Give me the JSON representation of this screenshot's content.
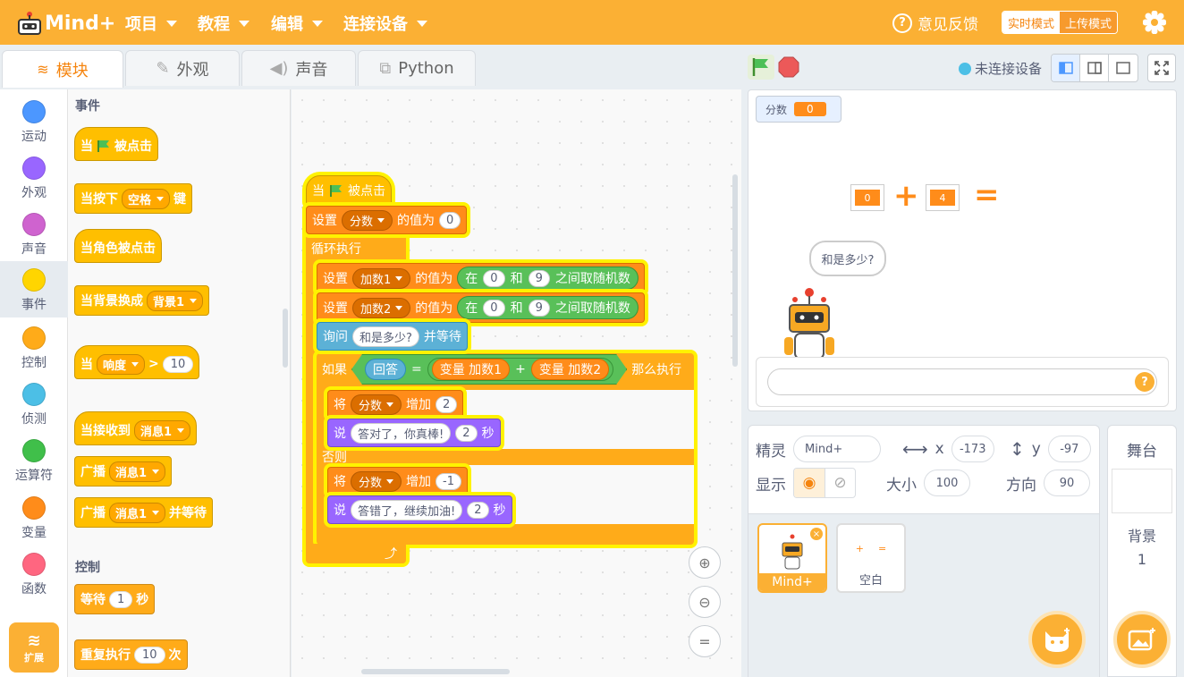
{
  "app": {
    "logo_text": "Mind+"
  },
  "menubar": {
    "menus": [
      {
        "label": "项目"
      },
      {
        "label": "教程"
      },
      {
        "label": "编辑"
      },
      {
        "label": "连接设备"
      }
    ],
    "feedback": "意见反馈",
    "mode_realtime": "实时模式",
    "mode_upload": "上传模式"
  },
  "tabs": [
    {
      "label": "模块"
    },
    {
      "label": "外观"
    },
    {
      "label": "声音"
    },
    {
      "label": "Python"
    }
  ],
  "categories": [
    {
      "label": "运动",
      "color": "#4c97ff"
    },
    {
      "label": "外观",
      "color": "#9966ff"
    },
    {
      "label": "声音",
      "color": "#cf63cf"
    },
    {
      "label": "事件",
      "color": "#ffd500"
    },
    {
      "label": "控制",
      "color": "#ffab19"
    },
    {
      "label": "侦测",
      "color": "#4cbfe6"
    },
    {
      "label": "运算符",
      "color": "#40bf4a"
    },
    {
      "label": "变量",
      "color": "#ff8c1a"
    },
    {
      "label": "函数",
      "color": "#ff6680"
    }
  ],
  "extension_label": "扩展",
  "palette": {
    "events_title": "事件",
    "when_flag_a": "当",
    "when_flag_b": "被点击",
    "key_a": "当按下",
    "key_drop": "空格",
    "key_b": "键",
    "sprite_clicked": "当角色被点击",
    "bg_a": "当背景换成",
    "bg_drop": "背景1",
    "loud_a": "当",
    "loud_drop": "响度",
    "loud_gt": ">",
    "loud_val": "10",
    "recv_a": "当接收到",
    "recv_drop": "消息1",
    "bc_a": "广播",
    "bc_drop": "消息1",
    "bcw_a": "广播",
    "bcw_drop": "消息1",
    "bcw_b": "并等待",
    "control_title": "控制",
    "wait_a": "等待",
    "wait_val": "1",
    "wait_b": "秒",
    "rep_a": "重复执行",
    "rep_val": "10",
    "rep_b": "次"
  },
  "script": {
    "hat_a": "当",
    "hat_b": "被点击",
    "set_a": "设置",
    "set_var": "分数",
    "set_b": "的值为",
    "set_val": "0",
    "forever": "循环执行",
    "s1_a": "设置",
    "s1_var": "加数1",
    "s1_b": "的值为",
    "s1_in": "在",
    "s1_lo": "0",
    "s1_and": "和",
    "s1_hi": "9",
    "s1_c": "之间取随机数",
    "s2_a": "设置",
    "s2_var": "加数2",
    "s2_b": "的值为",
    "s2_in": "在",
    "s2_lo": "0",
    "s2_and": "和",
    "s2_hi": "9",
    "s2_c": "之间取随机数",
    "ask_a": "询问",
    "ask_text": "和是多少?",
    "ask_b": "并等待",
    "if_a": "如果",
    "answer": "回答",
    "eq": "=",
    "v1": "变量 加数1",
    "plus": "+",
    "v2": "变量 加数2",
    "then": "那么执行",
    "c1_a": "将",
    "c1_var": "分数",
    "c1_b": "增加",
    "c1_val": "2",
    "say1_a": "说",
    "say1_text": "答对了，你真棒!",
    "say1_val": "2",
    "say1_b": "秒",
    "else": "否则",
    "c2_a": "将",
    "c2_var": "分数",
    "c2_b": "增加",
    "c2_val": "-1",
    "say2_a": "说",
    "say2_text": "答错了，继续加油!",
    "say2_val": "2",
    "say2_b": "秒"
  },
  "stage_header": {
    "connection": "未连接设备"
  },
  "stage": {
    "monitor_label": "分数",
    "monitor_value": "0",
    "addend1": "0",
    "plus": "+",
    "addend2": "4",
    "equals": "=",
    "speech": "和是多少?",
    "ask_ok": "?"
  },
  "sprite_info": {
    "sprite_label": "精灵",
    "sprite_name": "Mind+",
    "x_label": "x",
    "x_value": "-173",
    "y_label": "y",
    "y_value": "-97",
    "show_label": "显示",
    "size_label": "大小",
    "size_value": "100",
    "dir_label": "方向",
    "dir_value": "90"
  },
  "sprites": [
    {
      "name": "Mind+"
    },
    {
      "name": "空白"
    }
  ],
  "blank_thumb": {
    "plus": "+",
    "eq": "="
  },
  "stage_pane": {
    "title": "舞台",
    "backdrop_label": "背景",
    "backdrop_count": "1"
  }
}
